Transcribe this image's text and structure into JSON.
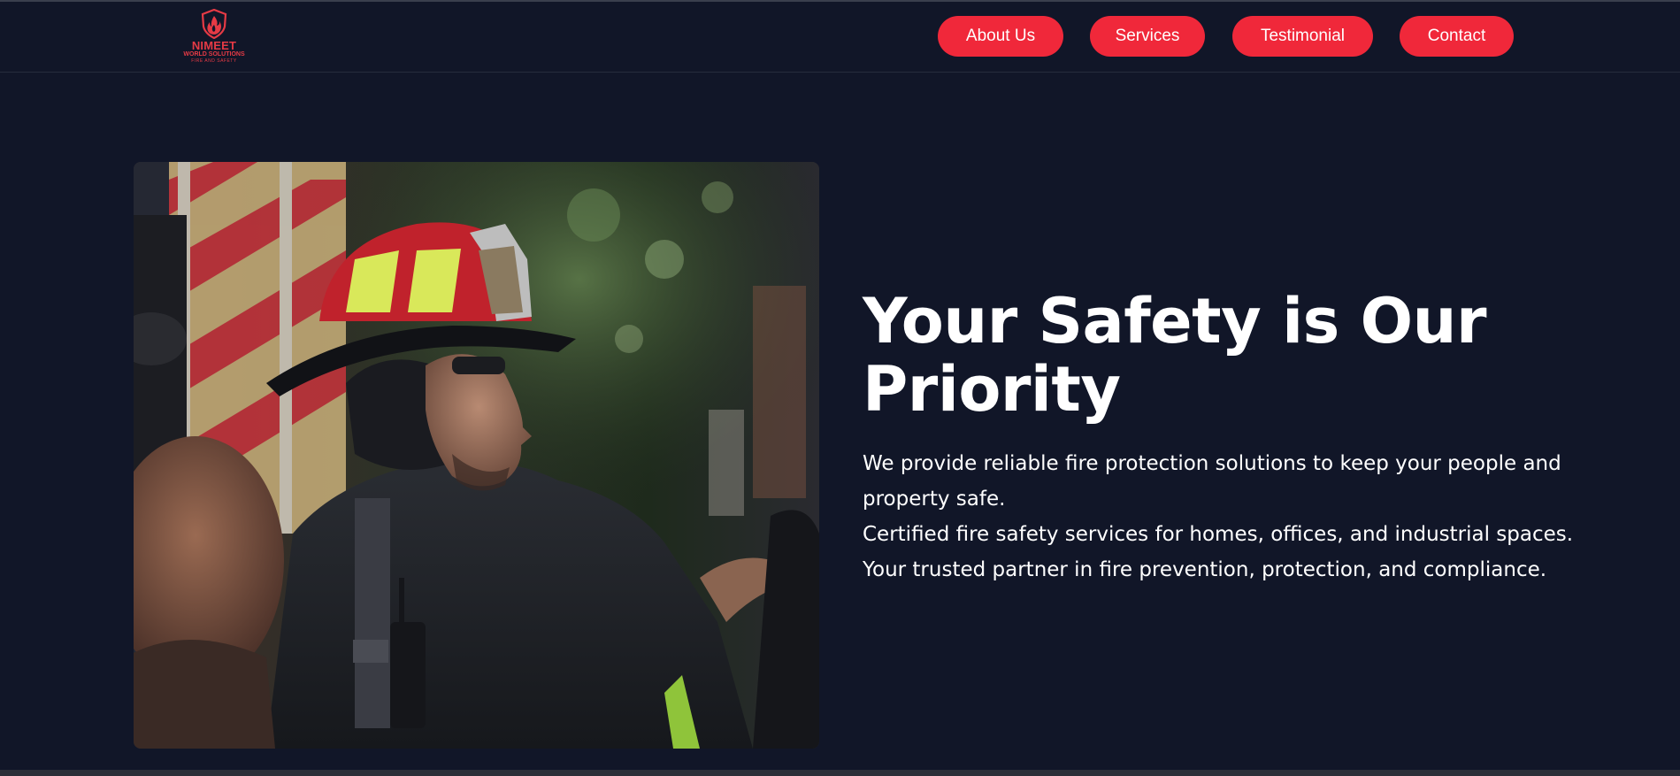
{
  "brand": {
    "name": "NIMEET",
    "subtitle": "WORLD SOLUTIONS",
    "tagline": "FIRE AND SAFETY",
    "logo_icon": "shield-flame-icon",
    "accent_color": "#f0283a"
  },
  "nav": {
    "items": [
      {
        "label": "About Us"
      },
      {
        "label": "Services"
      },
      {
        "label": "Testimonial"
      },
      {
        "label": "Contact"
      }
    ]
  },
  "hero": {
    "title": "Your Safety is Our Priority",
    "paragraphs": [
      "We provide reliable fire protection solutions to keep your people and property safe.",
      "Certified fire safety services for homes, offices, and industrial spaces.",
      "Your trusted partner in fire prevention, protection, and compliance."
    ],
    "image": "firefighter-photo"
  },
  "colors": {
    "background": "#111628",
    "button": "#f0283a",
    "text": "#ffffff"
  }
}
